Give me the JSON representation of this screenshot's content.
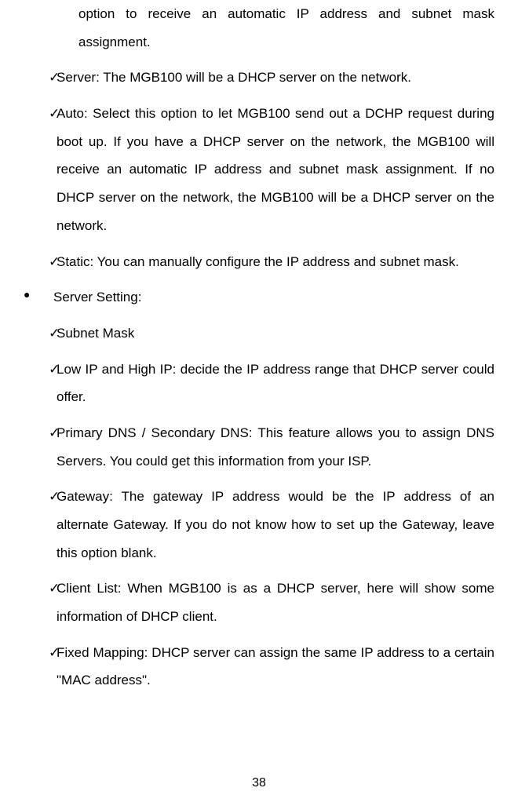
{
  "continuation_text": "option to receive an automatic IP address and subnet mask assignment.",
  "items_first": [
    {
      "text": "Server: The MGB100 will be a DHCP server on the network."
    },
    {
      "text": "Auto: Select this option to let MGB100 send out a DCHP request during boot up. If you have a DHCP server on the network, the MGB100 will receive an automatic IP address and subnet mask assignment. If no DHCP server on the network, the MGB100 will be a DHCP server on the network."
    },
    {
      "text": "Static: You can manually configure the IP address and subnet mask."
    }
  ],
  "bullet_heading": "Server Setting:",
  "items_second": [
    {
      "text": "Subnet Mask"
    },
    {
      "text": "Low IP and High IP: decide the IP address range that DHCP server could offer."
    },
    {
      "text": "Primary DNS / Secondary DNS: This feature allows you to assign DNS Servers. You could get this information from your ISP."
    },
    {
      "text": "Gateway: The gateway IP address would be the IP address of an alternate Gateway. If you do not know how to set up the Gateway, leave this option blank."
    },
    {
      "text": "Client List: When MGB100 is as a DHCP server, here will show some information of DHCP client."
    },
    {
      "text": "Fixed Mapping: DHCP server can assign the same IP address to a certain \"MAC address\"."
    }
  ],
  "checkmark_symbol": "✓",
  "bullet_symbol": "●",
  "page_number": "38"
}
